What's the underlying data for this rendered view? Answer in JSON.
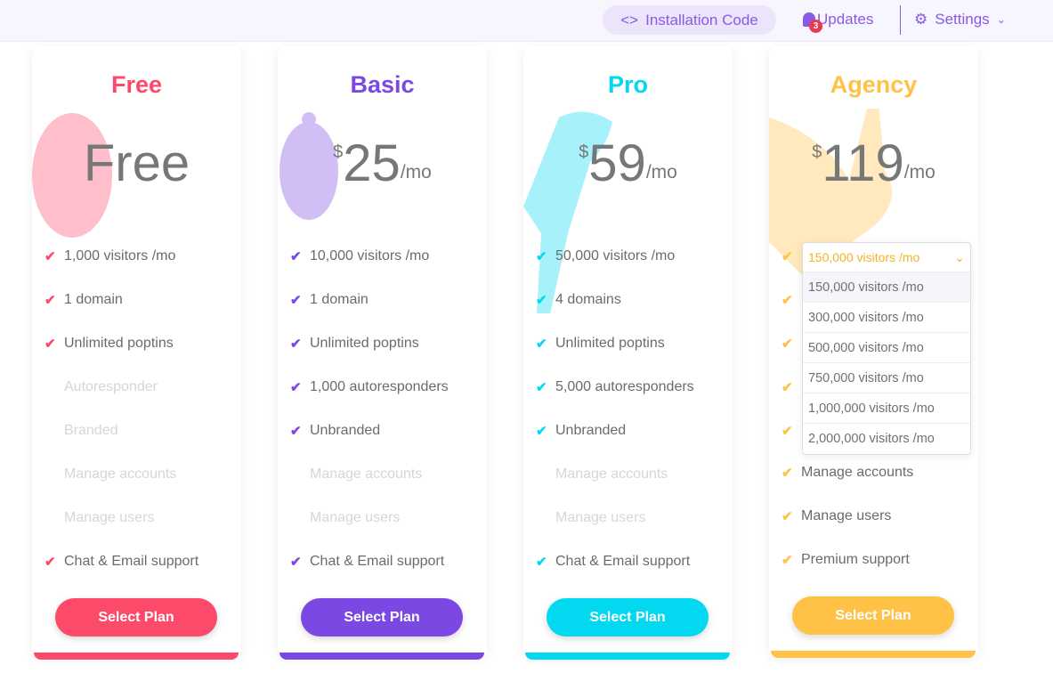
{
  "topbar": {
    "install_label": "Installation Code",
    "updates_label": "Updates",
    "updates_count": "3",
    "settings_label": "Settings"
  },
  "plans": [
    {
      "name": "Free",
      "color": "#fe4a6a",
      "price_text": "Free",
      "features": [
        {
          "text": "1,000 visitors /mo",
          "on": true
        },
        {
          "text": "1 domain",
          "on": true
        },
        {
          "text": "Unlimited poptins",
          "on": true
        },
        {
          "text": "Autoresponder",
          "on": false
        },
        {
          "text": "Branded",
          "on": false
        },
        {
          "text": "Manage accounts",
          "on": false
        },
        {
          "text": "Manage users",
          "on": false
        },
        {
          "text": "Chat & Email support",
          "on": true
        }
      ],
      "button": "Select Plan"
    },
    {
      "name": "Basic",
      "color": "#7c48e3",
      "currency": "$",
      "amount": "25",
      "period": "/mo",
      "features": [
        {
          "text": "10,000 visitors /mo",
          "on": true
        },
        {
          "text": "1 domain",
          "on": true
        },
        {
          "text": "Unlimited poptins",
          "on": true
        },
        {
          "text": "1,000 autoresponders",
          "on": true
        },
        {
          "text": "Unbranded",
          "on": true
        },
        {
          "text": "Manage accounts",
          "on": false
        },
        {
          "text": "Manage users",
          "on": false
        },
        {
          "text": "Chat & Email support",
          "on": true
        }
      ],
      "button": "Select Plan"
    },
    {
      "name": "Pro",
      "color": "#02d9f1",
      "currency": "$",
      "amount": "59",
      "period": "/mo",
      "features": [
        {
          "text": "50,000 visitors /mo",
          "on": true
        },
        {
          "text": "4 domains",
          "on": true
        },
        {
          "text": "Unlimited poptins",
          "on": true
        },
        {
          "text": "5,000 autoresponders",
          "on": true
        },
        {
          "text": "Unbranded",
          "on": true
        },
        {
          "text": "Manage accounts",
          "on": false
        },
        {
          "text": "Manage users",
          "on": false
        },
        {
          "text": "Chat & Email support",
          "on": true
        }
      ],
      "button": "Select Plan"
    },
    {
      "name": "Agency",
      "color": "#ffc146",
      "currency": "$",
      "amount": "119",
      "period": "/mo",
      "features": [
        {
          "text": "",
          "on": true
        },
        {
          "text": "",
          "on": true
        },
        {
          "text": "",
          "on": true
        },
        {
          "text": "",
          "on": true
        },
        {
          "text": "",
          "on": true
        },
        {
          "text": "Manage accounts",
          "on": true
        },
        {
          "text": "Manage users",
          "on": true
        },
        {
          "text": "Premium support",
          "on": true
        }
      ],
      "button": "Select Plan"
    }
  ],
  "visitors_dropdown": {
    "selected": "150,000 visitors /mo",
    "options": [
      "150,000 visitors /mo",
      "300,000 visitors /mo",
      "500,000 visitors /mo",
      "750,000 visitors /mo",
      "1,000,000 visitors /mo",
      "2,000,000 visitors /mo"
    ]
  }
}
